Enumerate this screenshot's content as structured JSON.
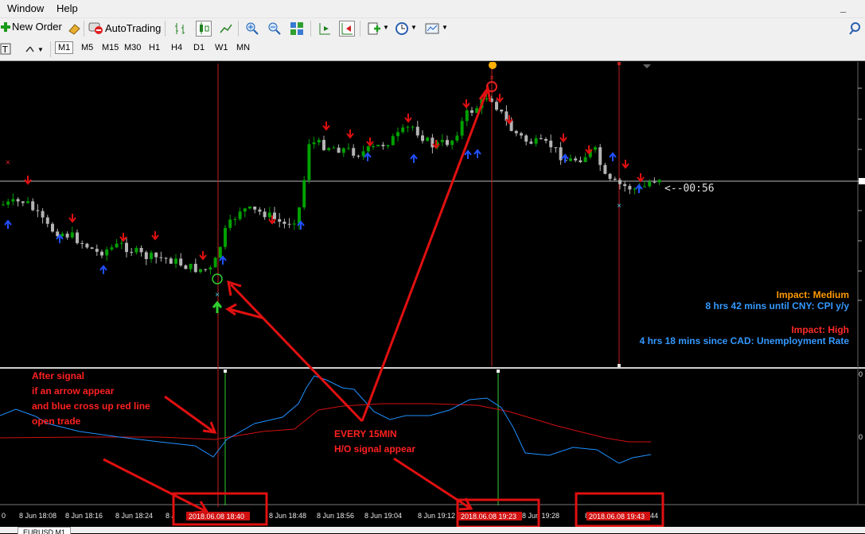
{
  "menu": {
    "items": [
      "Window",
      "Help"
    ]
  },
  "toolbar": {
    "new_order_label": "New Order",
    "autotrading_label": "AutoTrading"
  },
  "timeframes": [
    "M1",
    "M5",
    "M15",
    "M30",
    "H1",
    "H4",
    "D1",
    "W1",
    "MN"
  ],
  "timeframe_selected": "M1",
  "chart": {
    "countdown": "<--00:56",
    "news": [
      {
        "impact": "Impact: Medium",
        "impact_color": "#ff9900",
        "text": "8 hrs 42 mins until CNY: CPI y/y",
        "text_color": "#3399ff"
      },
      {
        "impact": "Impact: High",
        "impact_color": "#ff2a2a",
        "text": "4 hrs 18 mins since CAD: Unemployment Rate",
        "text_color": "#3399ff"
      }
    ],
    "annotation_left": [
      "After signal",
      "if an arrow appear",
      "and blue cross up red line",
      "open trade"
    ],
    "annotation_center": [
      "EVERY 15MIN",
      "H/O signal appear"
    ],
    "time_labels": [
      "8 Jun 18:08",
      "8 Jun 18:16",
      "8 Jun 18:24",
      "8 Jun 18:48",
      "8 Jun 18:56",
      "8 Jun 19:04",
      "8 Jun 19:28"
    ],
    "highlight_times": [
      "2018.06.08 18:40",
      "2018.06.08 19:23",
      "2018.06.08 19:43"
    ],
    "axis_fragments": {
      "left_edge": "0",
      "right_edge": "44",
      "right_ticks": [
        "0",
        "0"
      ]
    },
    "colors": {
      "bull": "#00a000",
      "bear": "#b4b4b4",
      "red_line": "#d01010",
      "blue_line": "#1e90ff",
      "annotation": "#ff2020"
    }
  },
  "bottom_tab": "EURUSD,M1"
}
